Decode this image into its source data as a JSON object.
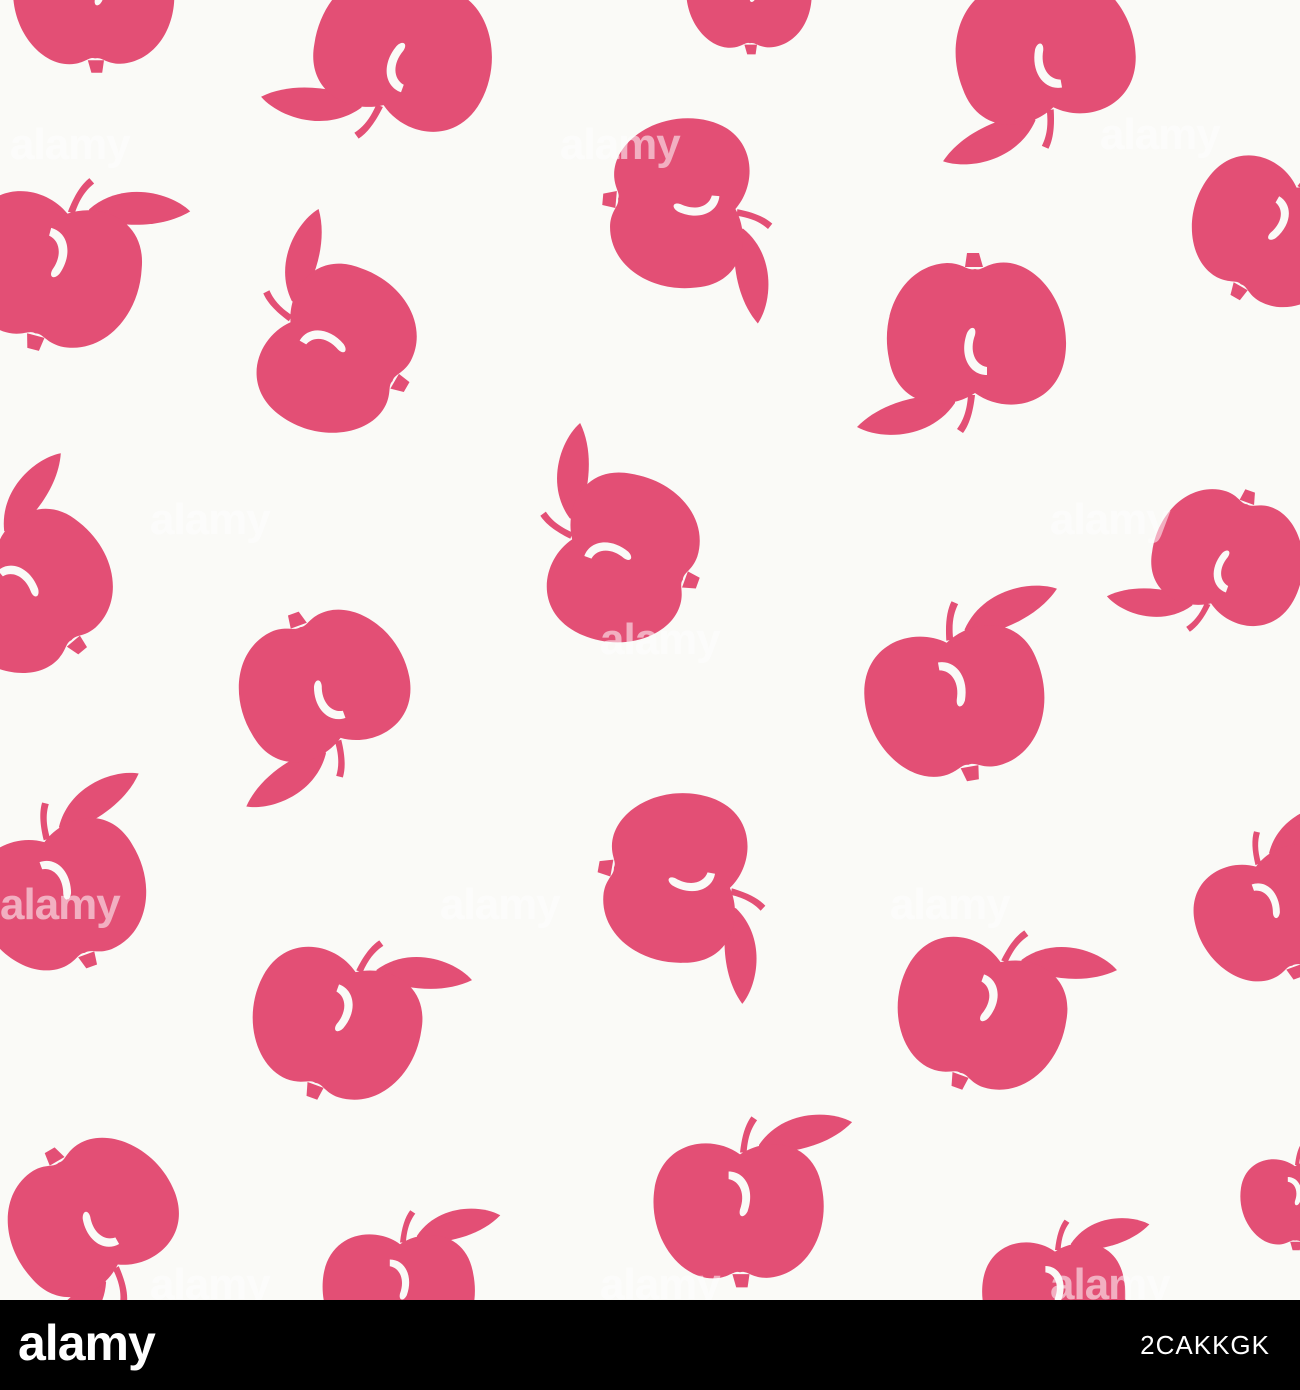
{
  "image": {
    "subject": "seamless-pattern",
    "background_color": "#fafaf7",
    "apple_color": "#e34f75",
    "highlight_color": "#fafaf7"
  },
  "watermark": {
    "text": "alamy"
  },
  "footer": {
    "logo": "alamy",
    "image_code": "2CAKKGK",
    "background_color": "#000000"
  }
}
